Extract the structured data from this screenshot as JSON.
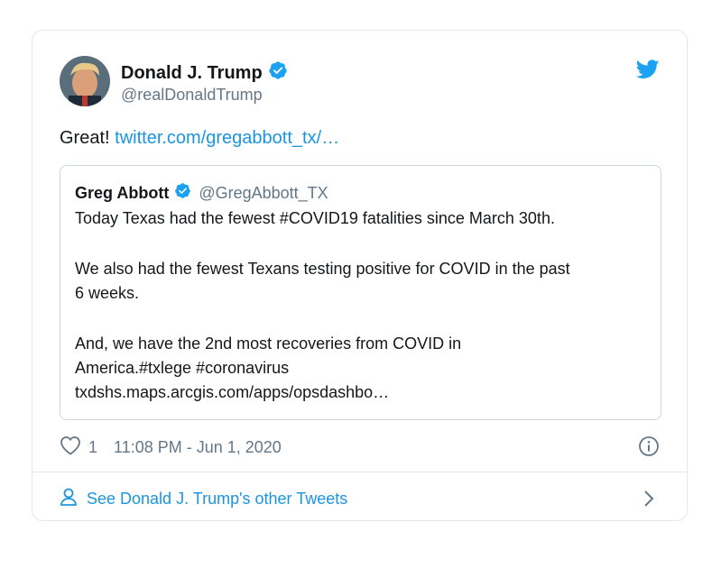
{
  "author": {
    "name": "Donald J. Trump",
    "handle": "@realDonaldTrump",
    "avatar_icon": "avatar",
    "verified": true
  },
  "tweet": {
    "text": "Great!",
    "link": "twitter.com/gregabbott_tx/…"
  },
  "quoted": {
    "name": "Greg Abbott",
    "handle": "@GregAbbott_TX",
    "verified": true,
    "lines": [
      "Today Texas had the fewest #COVID19 fatalities since March 30th.",
      "We also had the fewest Texans testing positive for COVID in the past",
      "6 weeks.",
      "And, we have the 2nd most recoveries from COVID in",
      "America.#txlege #coronavirus",
      "txdshs.maps.arcgis.com/apps/opsdashbo…"
    ]
  },
  "meta": {
    "likes": "1",
    "timestamp": "11:08 PM - Jun 1, 2020"
  },
  "footer": {
    "label": "See Donald J. Trump's other Tweets"
  },
  "colors": {
    "link": "#1b95e0",
    "verified": "#1da1f2",
    "secondary": "#657786",
    "border": "#e1e8ed"
  },
  "icons": [
    "twitter-bird-icon",
    "verified-icon",
    "heart-icon",
    "info-icon",
    "person-icon",
    "chevron-right-icon"
  ]
}
